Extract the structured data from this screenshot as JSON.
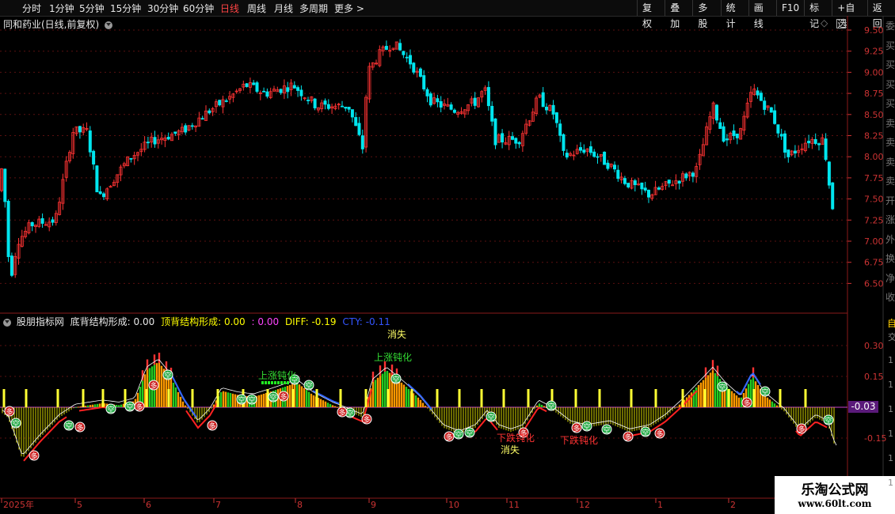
{
  "toolbar": {
    "periods": [
      "分时",
      "1分钟",
      "5分钟",
      "15分钟",
      "30分钟",
      "60分钟",
      "日线",
      "周线",
      "月线",
      "多周期",
      "更多 >"
    ],
    "active_period": "日线",
    "right_buttons": [
      "复权",
      "叠加",
      "多股",
      "统计",
      "画线",
      "F10",
      "标记",
      "+自选",
      "返回"
    ]
  },
  "chart_title": "同和药业(日线,前复权)",
  "side_tabs": [
    "委",
    "买",
    "买",
    "买",
    "买",
    "卖",
    "卖",
    "卖",
    "卖",
    "开",
    "涨",
    "外",
    "换",
    "净",
    "收"
  ],
  "price_axis": [
    "9.50",
    "9.25",
    "9.00",
    "8.75",
    "8.50",
    "8.25",
    "8.00",
    "7.75",
    "7.50",
    "7.25",
    "7.00",
    "6.75",
    "6.50"
  ],
  "indicator": {
    "name": "股朋指标网",
    "bottom_label": "底背结构形成:",
    "bottom_value": "0.00",
    "top_label": "顶背结构形成:",
    "top_value": "0.00",
    "sep": ":",
    "sep_value": "0.00",
    "diff_label": "DIFF:",
    "diff_value": "-0.19",
    "cty_label": "CTY:",
    "cty_value": "-0.11",
    "axis": [
      "0.30",
      "0.15",
      "-0.15"
    ],
    "current_value": "-0.03",
    "right_tab": "自",
    "annotations": {
      "vanish": "消失",
      "rise_blunt": "上涨钝化",
      "fall_blunt": "下跌钝化"
    },
    "marker_kong": "空",
    "marker_duo": "多",
    "right_edge_marks": [
      "交",
      "1",
      "1",
      "1",
      "1",
      "1",
      "1"
    ]
  },
  "date_axis": [
    "2025年",
    "5",
    "6",
    "7",
    "8",
    "9",
    "10",
    "11",
    "12",
    "1",
    "2"
  ],
  "brand": {
    "name": "乐淘公式网",
    "url": "www.60lt.com"
  },
  "colors": {
    "up": "#ff3333",
    "down": "#00e5ee",
    "green": "#22cc22",
    "orange": "#ff9900",
    "yellow": "#ffff00"
  }
}
